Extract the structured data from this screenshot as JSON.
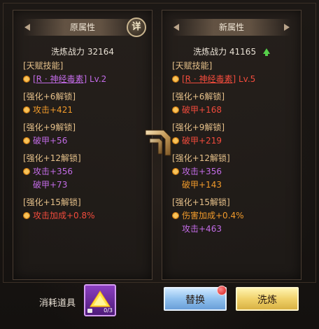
{
  "left": {
    "title": "原属性",
    "detail_label": "详",
    "power_label": "洗炼战力",
    "power_value": "32164",
    "talent_header": "[天赋技能]",
    "skill_name": "[R · 神经毒素]",
    "skill_level": "Lv.2",
    "groups": [
      {
        "header": "[强化+6解锁]",
        "lines": [
          {
            "text": "攻击+421",
            "color": "orange",
            "star": true
          }
        ]
      },
      {
        "header": "[强化+9解锁]",
        "lines": [
          {
            "text": "破甲+56",
            "color": "purple",
            "star": true
          }
        ]
      },
      {
        "header": "[强化+12解锁]",
        "lines": [
          {
            "text": "攻击+356",
            "color": "purple",
            "star": true
          },
          {
            "text": "破甲+73",
            "color": "purple",
            "star": false
          }
        ]
      },
      {
        "header": "[强化+15解锁]",
        "lines": [
          {
            "text": "攻击加成+0.8%",
            "color": "red",
            "star": true
          }
        ]
      }
    ]
  },
  "right": {
    "title": "新属性",
    "power_label": "洗炼战力",
    "power_value": "41165",
    "talent_header": "[天赋技能]",
    "skill_name": "[R · 神经毒素]",
    "skill_level": "Lv.5",
    "groups": [
      {
        "header": "[强化+6解锁]",
        "lines": [
          {
            "text": "破甲+168",
            "color": "red",
            "star": true
          }
        ]
      },
      {
        "header": "[强化+9解锁]",
        "lines": [
          {
            "text": "破甲+219",
            "color": "red",
            "star": true
          }
        ]
      },
      {
        "header": "[强化+12解锁]",
        "lines": [
          {
            "text": "攻击+356",
            "color": "purple",
            "star": true
          },
          {
            "text": "破甲+143",
            "color": "orange",
            "star": false
          }
        ]
      },
      {
        "header": "[强化+15解锁]",
        "lines": [
          {
            "text": "伤害加成+0.4%",
            "color": "orange",
            "star": true
          },
          {
            "text": "攻击+463",
            "color": "purple",
            "star": false
          }
        ]
      }
    ]
  },
  "bottom": {
    "consume_label": "消耗道具",
    "item_count": "0/3",
    "replace_label": "替换",
    "refine_label": "洗炼"
  },
  "colors": {
    "purple": "#c26be6",
    "orange": "#f09a2b",
    "red": "#f24b3c",
    "header": "#e5c08a",
    "up_arrow": "#56d04a"
  },
  "icons": [
    "detail-icon",
    "power-up-arrow-icon",
    "attribute-star-icon",
    "transfer-arrow-icon",
    "consumable-item-icon",
    "lock-icon",
    "notification-dot-icon"
  ]
}
